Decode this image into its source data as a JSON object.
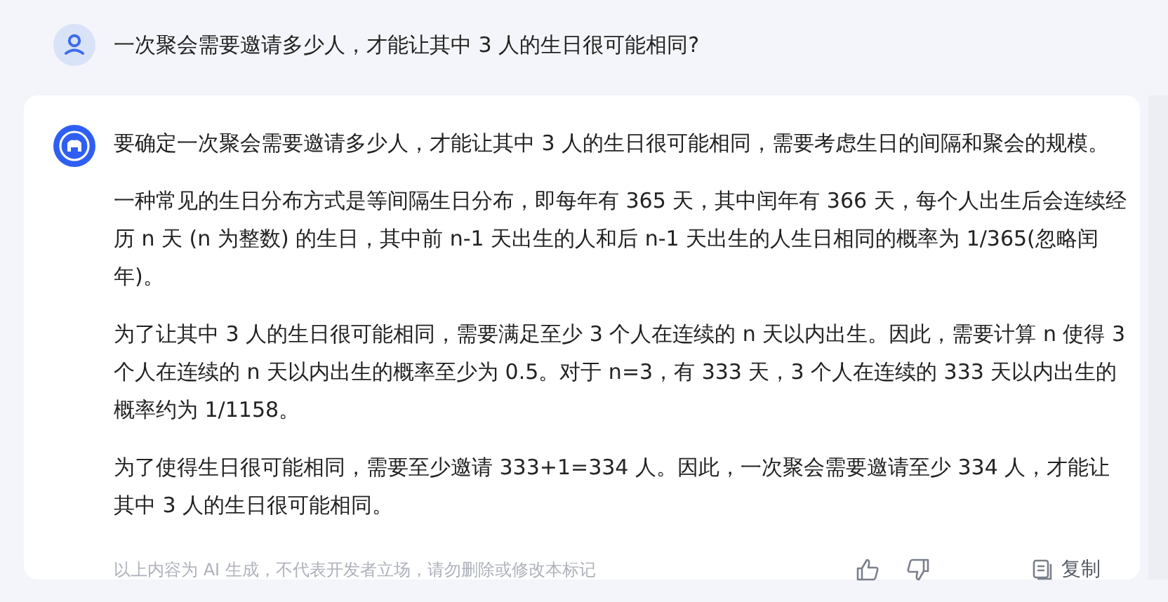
{
  "question": {
    "text": "一次聚会需要邀请多少人，才能让其中 3 人的生日很可能相同?"
  },
  "answer": {
    "paragraphs": [
      "要确定一次聚会需要邀请多少人，才能让其中 3 人的生日很可能相同，需要考虑生日的间隔和聚会的规模。",
      "一种常见的生日分布方式是等间隔生日分布，即每年有 365 天，其中闰年有 366 天，每个人出生后会连续经历 n 天 (n 为整数) 的生日，其中前 n-1 天出生的人和后 n-1 天出生的人生日相同的概率为 1/365(忽略闰年)。",
      "为了让其中 3 人的生日很可能相同，需要满足至少 3 个人在连续的 n 天以内出生。因此，需要计算 n 使得 3 个人在连续的 n 天以内出生的概率至少为 0.5。对于 n=3，有 333 天，3 个人在连续的 333 天以内出生的概率约为 1/1158。",
      "为了使得生日很可能相同，需要至少邀请 333+1=334 人。因此，一次聚会需要邀请至少 334 人，才能让其中 3 人的生日很可能相同。"
    ],
    "disclaimer": "以上内容为 AI 生成，不代表开发者立场，请勿删除或修改本标记",
    "copy_label": "复制"
  }
}
